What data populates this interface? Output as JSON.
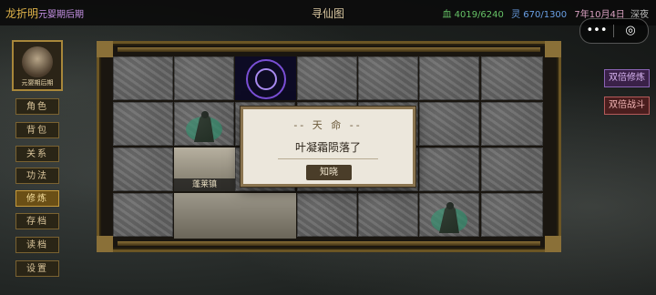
{
  "header": {
    "hero_name": "龙折明",
    "realm": "元婴期后期",
    "title": "寻仙图",
    "hp": "血 4019/6240",
    "ling": "灵 670/1300",
    "date": "7年10月4日",
    "time": "深夜"
  },
  "capsule": {
    "more": "•••",
    "close": "◎"
  },
  "avatar": {
    "caption": "元婴期后期"
  },
  "menu": [
    {
      "label": "角色"
    },
    {
      "label": "背包"
    },
    {
      "label": "关系"
    },
    {
      "label": "功法"
    },
    {
      "label": "修炼"
    },
    {
      "label": "存档"
    },
    {
      "label": "读档"
    },
    {
      "label": "设置"
    }
  ],
  "right_buttons": {
    "double_cultivate": "双倍修炼",
    "double_battle": "双倍战斗"
  },
  "map": {
    "town_label": "蓬莱镇"
  },
  "dialog": {
    "title": "-- 天 命 --",
    "message": "叶凝霜陨落了",
    "confirm": "知晓"
  },
  "colors": {
    "accent": "#e0b34a",
    "realm": "#c792e6",
    "hp": "#66c266",
    "ling": "#6aa0e6",
    "active_menu": "#6a4f16"
  }
}
